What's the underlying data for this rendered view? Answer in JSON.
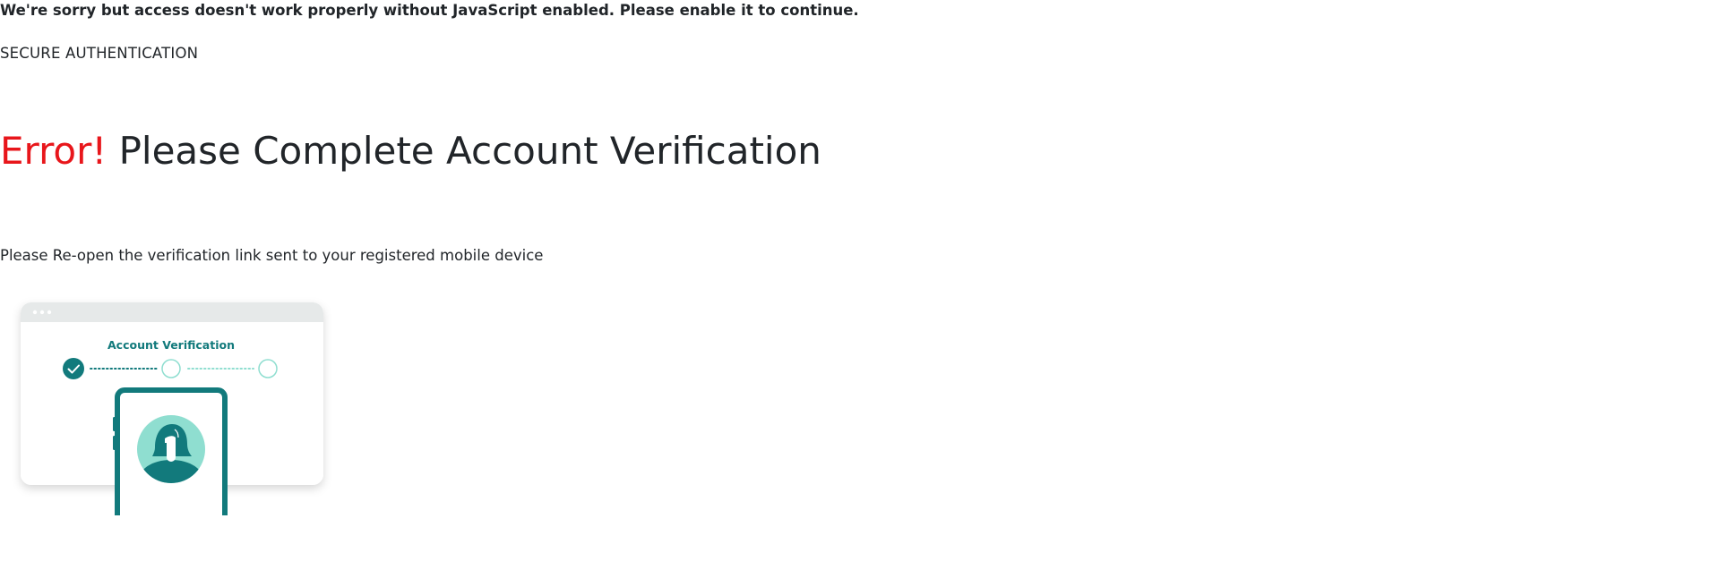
{
  "noscript": {
    "message": "We're sorry but access doesn't work properly without JavaScript enabled. Please enable it to continue."
  },
  "page": {
    "kicker": "SECURE AUTHENTICATION",
    "headline_error": "Error!",
    "headline_rest": "Please Complete Account Verification",
    "instruction": "Please Re-open the verification link sent to your registered mobile device"
  },
  "illustration": {
    "card_title": "Account Verification",
    "steps_completed": 1,
    "steps_total": 3,
    "colors": {
      "primary": "#127a7c",
      "accent": "#8fded0",
      "card_header": "#e6e9e9"
    }
  },
  "colors": {
    "error": "#e8161b",
    "text": "#212529"
  }
}
